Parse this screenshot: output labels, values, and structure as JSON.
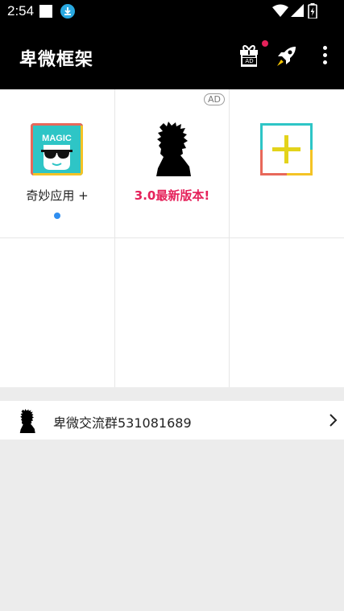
{
  "status_bar": {
    "time": "2:54"
  },
  "app_bar": {
    "title": "卑微框架",
    "gift_ad_label": "AD"
  },
  "grid": {
    "cells": [
      {
        "label": "奇妙应用 +",
        "icon": "magic-glasses-icon",
        "has_dot": true
      },
      {
        "label": "3.0最新版本!",
        "icon": "silhouette-icon",
        "ad_badge": "AD",
        "label_color": "#e5215a"
      },
      {
        "label": "",
        "icon": "add-plus-icon"
      }
    ]
  },
  "group": {
    "label": "卑微交流群531081689"
  },
  "colors": {
    "accent_red": "#e5215a",
    "dot_blue": "#2f8ef0",
    "magic_teal": "#2ec5c6"
  }
}
